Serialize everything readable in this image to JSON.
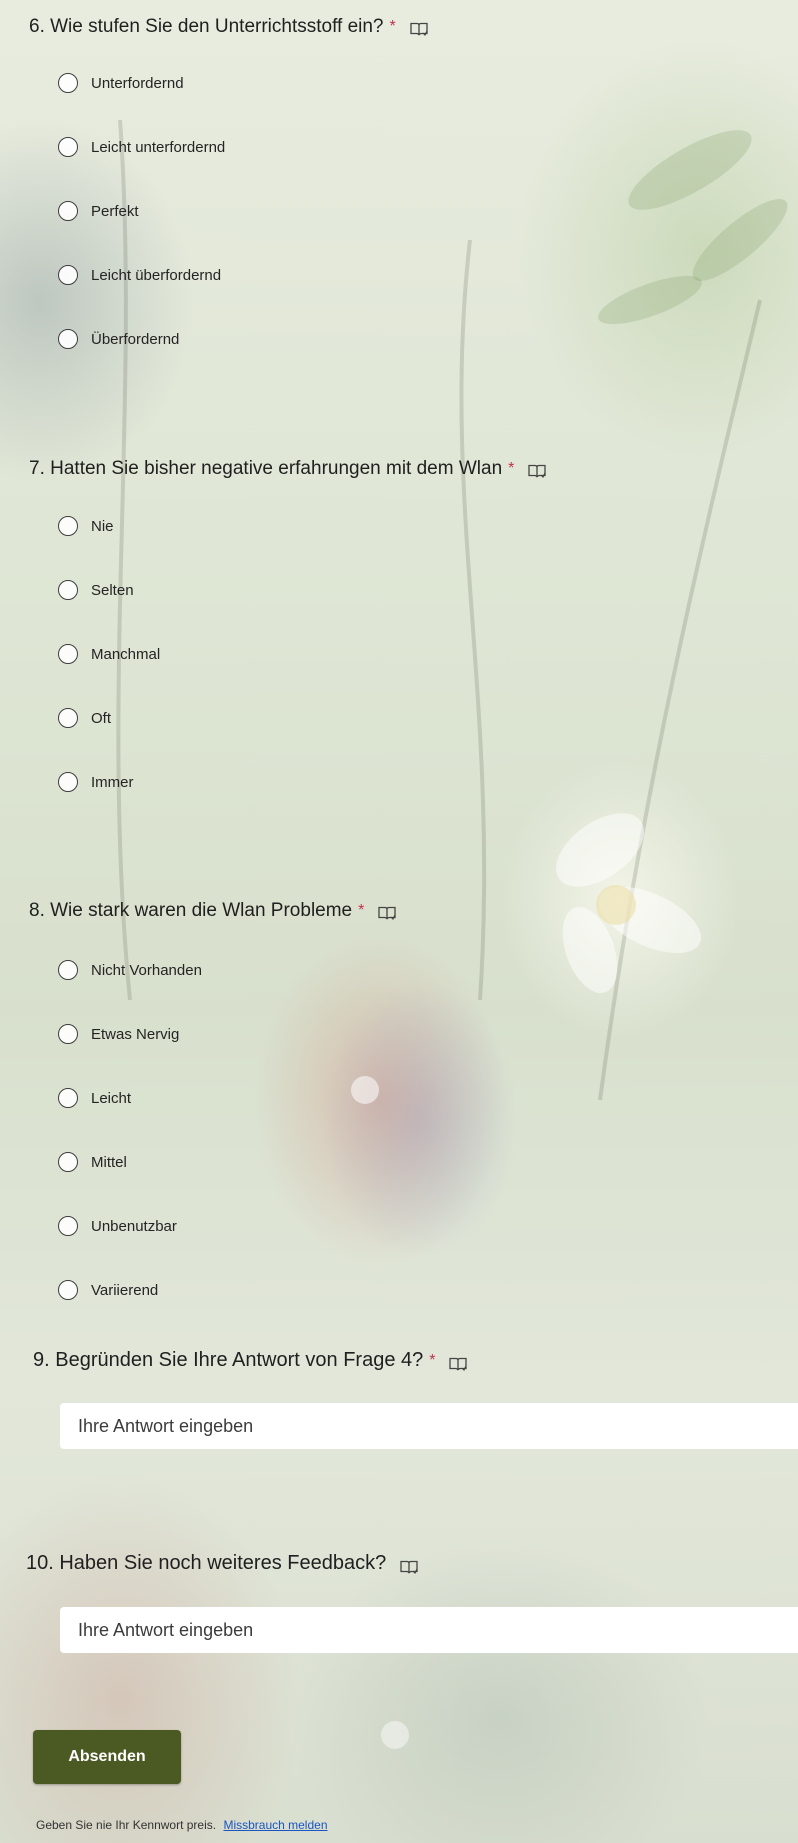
{
  "questions": [
    {
      "title": "6. Wie stufen Sie den Unterrichtsstoff ein?",
      "required_mark": "*",
      "options": [
        "Unterfordernd",
        "Leicht unterfordernd",
        "Perfekt",
        "Leicht überfordernd",
        "Überfordernd"
      ]
    },
    {
      "title": "7. Hatten Sie bisher negative erfahrungen mit dem Wlan",
      "required_mark": "*",
      "options": [
        "Nie",
        "Selten",
        "Manchmal",
        "Oft",
        "Immer"
      ]
    },
    {
      "title": "8. Wie stark waren die Wlan Probleme",
      "required_mark": "*",
      "options": [
        "Nicht Vorhanden",
        "Etwas Nervig",
        "Leicht",
        "Mittel",
        "Unbenutzbar",
        "Variierend"
      ]
    },
    {
      "title": "9. Begründen Sie Ihre Antwort von Frage 4?",
      "required_mark": "*",
      "placeholder": "Ihre Antwort eingeben"
    },
    {
      "title": "10. Haben Sie noch weiteres Feedback?",
      "placeholder": "Ihre Antwort eingeben"
    }
  ],
  "submit_label": "Absenden",
  "footer": {
    "notice": "Geben Sie nie Ihr Kennwort preis.",
    "report_link": "Missbrauch melden"
  },
  "colors": {
    "accent": "#4b5a23",
    "required": "#c4314b",
    "link": "#1a55c2"
  },
  "icons": [
    "immersive-reader-icon"
  ]
}
